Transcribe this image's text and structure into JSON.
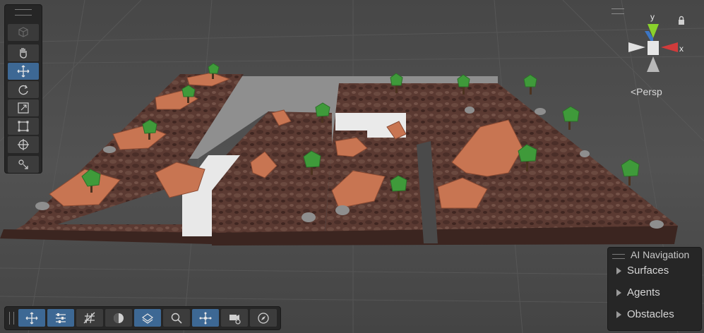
{
  "scene": {
    "persp_label": "<Persp",
    "gizmo_axes": {
      "y": "y",
      "x": "x"
    },
    "colors": {
      "x_axis": "#d13b3b",
      "y_axis": "#8ad12c",
      "z_axis": "#3b7bd1",
      "active": "#3d6894",
      "panel": "#262626"
    }
  },
  "tools": [
    {
      "name": "view-tool-icon",
      "active": false
    },
    {
      "name": "hand-tool-icon",
      "active": false
    },
    {
      "name": "move-tool-icon",
      "active": true
    },
    {
      "name": "rotate-tool-icon",
      "active": false
    },
    {
      "name": "scale-tool-icon",
      "active": false
    },
    {
      "name": "rect-tool-icon",
      "active": false
    },
    {
      "name": "transform-tool-icon",
      "active": false
    },
    {
      "name": "custom-tool-icon",
      "active": false
    }
  ],
  "ai_navigation": {
    "title": "AI Navigation",
    "items": [
      {
        "label": "Surfaces"
      },
      {
        "label": "Agents"
      },
      {
        "label": "Obstacles"
      }
    ]
  },
  "bottom_toolbar": [
    {
      "name": "move-toggle-icon",
      "active": true
    },
    {
      "name": "settings-toggle-icon",
      "active": true
    },
    {
      "name": "grid-icon",
      "active": false
    },
    {
      "name": "shading-icon",
      "active": false
    },
    {
      "name": "layers-icon",
      "active": true
    },
    {
      "name": "search-icon",
      "active": false
    },
    {
      "name": "snap-icon",
      "active": true
    },
    {
      "name": "camera-icon",
      "active": false
    },
    {
      "name": "compass-icon",
      "active": false
    }
  ]
}
